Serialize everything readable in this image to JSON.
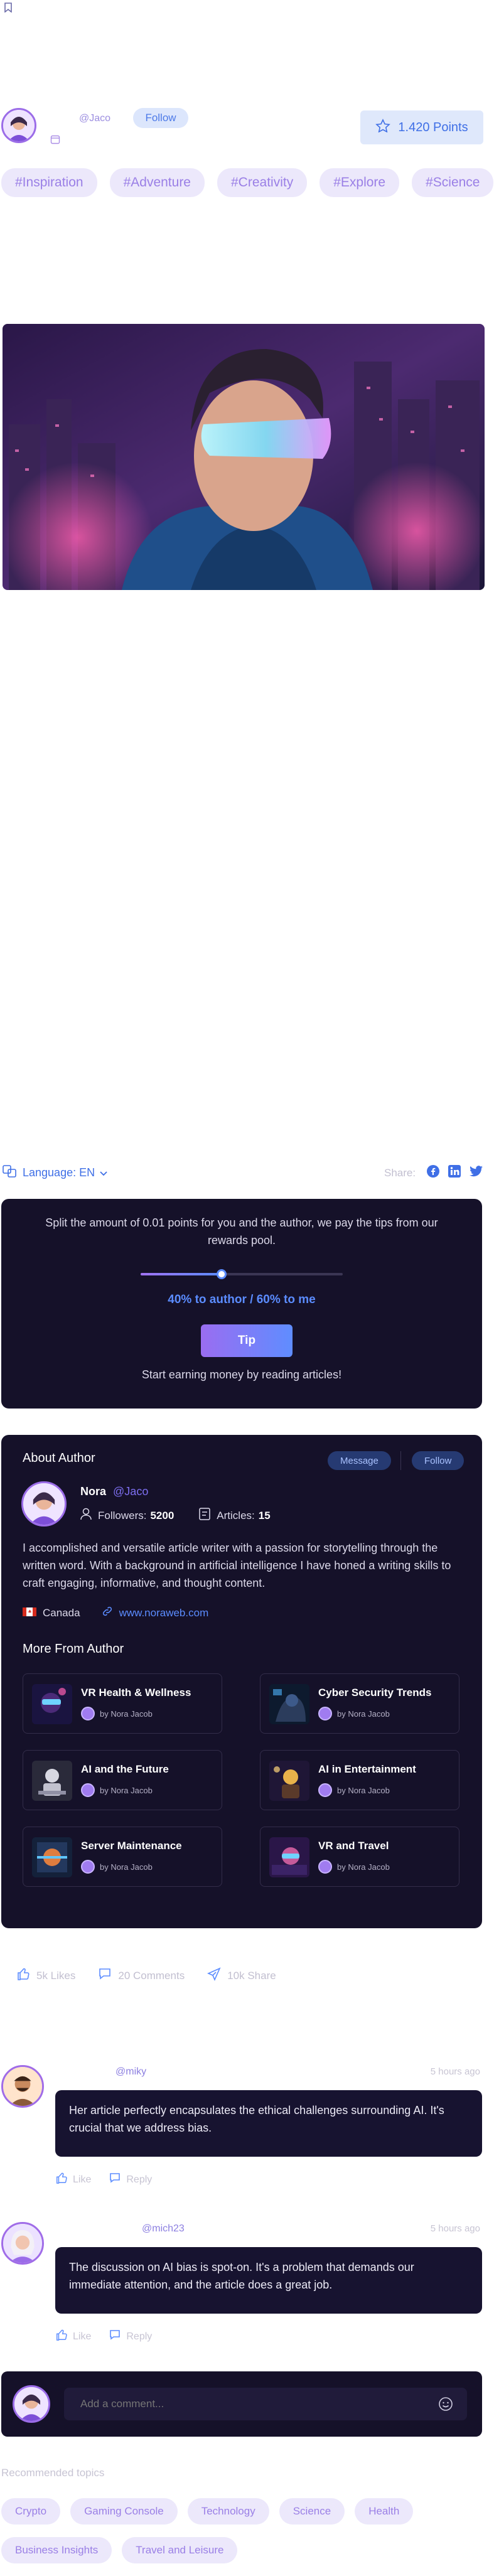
{
  "author_handle": "@Jaco",
  "follow_label": "Follow",
  "points_label": "1.420 Points",
  "tags": [
    "#Inspiration",
    "#Adventure",
    "#Creativity",
    "#Explore",
    "#Science"
  ],
  "language_label": "Language: EN",
  "share_label": "Share:",
  "tip": {
    "description": "Split the amount of 0.01 points for you and the author, we pay the tips from our rewards pool.",
    "split_label": "40% to author / 60% to me",
    "slider_value": 0.4,
    "button": "Tip",
    "footer": "Start earning money by reading articles!"
  },
  "about": {
    "heading": "About Author",
    "message_btn": "Message",
    "follow_btn": "Follow",
    "name": "Nora",
    "handle": "@Jaco",
    "followers_label": "Followers:",
    "followers": "5200",
    "articles_label": "Articles:",
    "articles": "15",
    "bio": "I accomplished and versatile article writer with a passion for storytelling through the written word. With a background in artificial intelligence I have honed a writing skills to craft engaging, informative, and thought content.",
    "country": "Canada",
    "website": "www.noraweb.com"
  },
  "more": {
    "heading": "More From Author",
    "items": [
      {
        "title": "VR Health & Wellness",
        "by": "by Nora Jacob"
      },
      {
        "title": "Cyber Security Trends",
        "by": "by Nora Jacob"
      },
      {
        "title": "AI and the Future",
        "by": "by Nora Jacob"
      },
      {
        "title": "AI in Entertainment",
        "by": "by Nora Jacob"
      },
      {
        "title": "Server Maintenance",
        "by": "by Nora Jacob"
      },
      {
        "title": "VR and Travel",
        "by": "by Nora Jacob"
      }
    ]
  },
  "reactions": {
    "likes": "5k Likes",
    "comments": "20 Comments",
    "share": "10k Share"
  },
  "comments": [
    {
      "user": "@miky",
      "time": "5 hours ago",
      "text": "Her article perfectly encapsulates the ethical challenges surrounding AI. It's crucial that we address bias.",
      "like": "Like",
      "reply": "Reply"
    },
    {
      "user": "@mich23",
      "time": "5 hours ago",
      "text": "The discussion on AI bias is spot-on. It's a problem that demands our immediate attention, and the article does a great job.",
      "like": "Like",
      "reply": "Reply"
    }
  ],
  "add_comment_placeholder": "Add a comment...",
  "recommended": {
    "heading": "Recommended topics",
    "topics": [
      "Crypto",
      "Gaming Console",
      "Technology",
      "Science",
      "Health",
      "Business Insights",
      "Travel and Leisure"
    ]
  }
}
